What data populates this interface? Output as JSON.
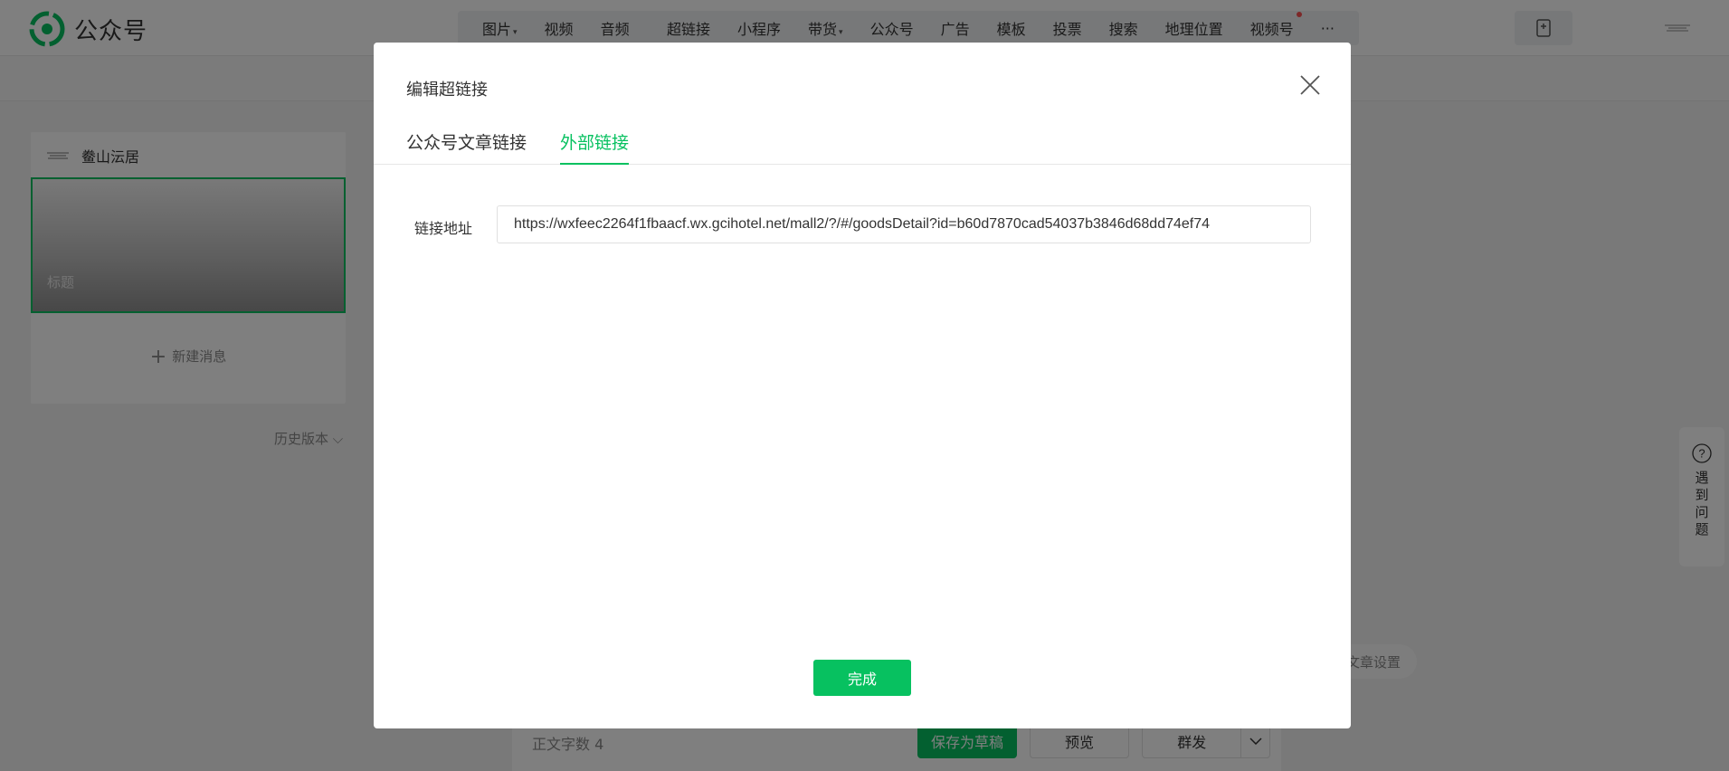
{
  "app": {
    "logo_text": "公众号",
    "brand_color": "#07c160"
  },
  "toolbar": {
    "group1": [
      {
        "label": "图片",
        "has_caret": true
      },
      {
        "label": "视频",
        "has_caret": false
      },
      {
        "label": "音频",
        "has_caret": false
      }
    ],
    "group2": [
      {
        "label": "超链接",
        "has_caret": false
      },
      {
        "label": "小程序",
        "has_caret": false
      },
      {
        "label": "带货",
        "has_caret": true
      },
      {
        "label": "公众号",
        "has_caret": false
      },
      {
        "label": "广告",
        "has_caret": false
      },
      {
        "label": "模板",
        "has_caret": false
      },
      {
        "label": "投票",
        "has_caret": false
      },
      {
        "label": "搜索",
        "has_caret": false
      },
      {
        "label": "地理位置",
        "has_caret": false
      },
      {
        "label": "视频号",
        "has_caret": false,
        "has_dot": true
      }
    ],
    "more": "···"
  },
  "left_panel": {
    "account_name": "鲞山沄居",
    "article_title_placeholder": "标题",
    "new_message": "新建消息",
    "history": "历史版本"
  },
  "bottom_bar": {
    "word_count_label": "正文字数",
    "word_count": "4",
    "save_draft": "保存为草稿",
    "preview": "预览",
    "mass_send": "群发"
  },
  "article_settings": "文章设置",
  "help": {
    "icon": "?",
    "text": "遇到问题"
  },
  "modal": {
    "title": "编辑超链接",
    "tabs": [
      {
        "label": "公众号文章链接",
        "active": false
      },
      {
        "label": "外部链接",
        "active": true
      }
    ],
    "field_label": "链接地址",
    "url_value": "https://wxfeec2264f1fbaacf.wx.gcihotel.net/mall2/?/#/goodsDetail?id=b60d7870cad54037b3846d68dd74ef74",
    "done_button": "完成"
  }
}
